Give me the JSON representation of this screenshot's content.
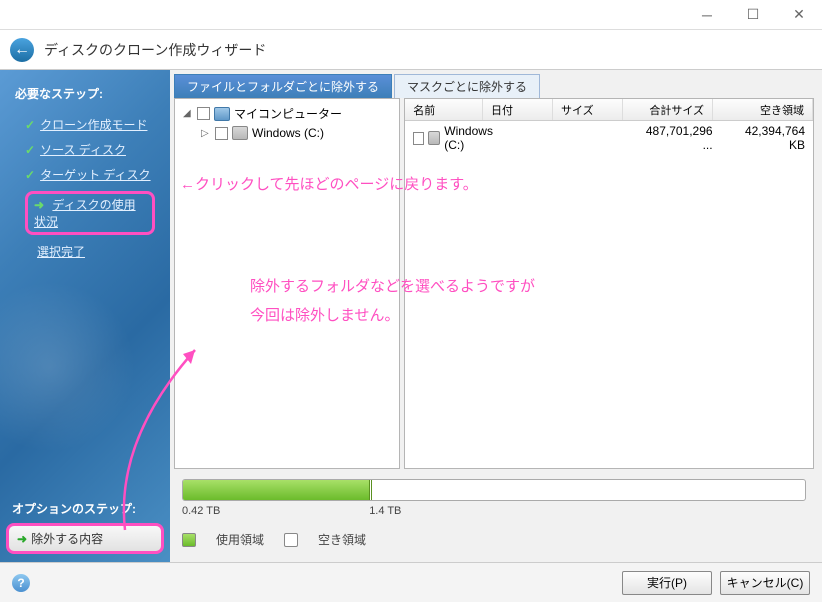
{
  "window_title": "ディスクのクローン作成ウィザード",
  "sidebar": {
    "section1": "必要なステップ:",
    "items": [
      {
        "label": "クローン作成モード",
        "icon": "check"
      },
      {
        "label": "ソース ディスク",
        "icon": "check"
      },
      {
        "label": "ターゲット ディスク",
        "icon": "check"
      },
      {
        "label": "ディスクの使用状況",
        "icon": "arrow",
        "highlighted": true
      },
      {
        "label": "選択完了",
        "icon": "none"
      }
    ],
    "section2": "オプションのステップ:",
    "option_item": "除外する内容"
  },
  "tabs": [
    {
      "label": "ファイルとフォルダごとに除外する",
      "active": true
    },
    {
      "label": "マスクごとに除外する",
      "active": false
    }
  ],
  "tree": {
    "root": "マイコンピューター",
    "child": "Windows (C:)"
  },
  "grid": {
    "headers": {
      "name": "名前",
      "date": "日付",
      "size": "サイズ",
      "total": "合計サイズ",
      "free": "空き領域"
    },
    "rows": [
      {
        "name": "Windows (C:)",
        "date": "",
        "size": "",
        "total": "487,701,296 ...",
        "free": "42,394,764 KB"
      }
    ]
  },
  "progress": {
    "used_label": "0.42 TB",
    "total_label": "1.4 TB",
    "legend_used": "使用領域",
    "legend_free": "空き領域"
  },
  "footer": {
    "execute": "実行(P)",
    "cancel": "キャンセル(C)"
  },
  "annotations": {
    "a1": "←クリックして先ほどのページに戻ります。",
    "a2": "除外するフォルダなどを選べるようですが\n今回は除外しません。"
  }
}
